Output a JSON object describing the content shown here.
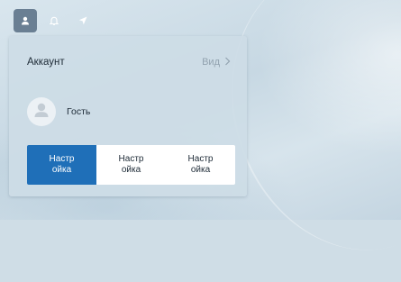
{
  "top_strip": {
    "buttons": [
      {
        "icon": "user-icon",
        "active": true
      },
      {
        "icon": "bell-icon",
        "active": false
      },
      {
        "icon": "location-arrow-icon",
        "active": false
      }
    ]
  },
  "panel": {
    "title": "Аккаунт",
    "view_link": "Вид",
    "user": {
      "name": "Гость",
      "avatar_icon": "user-avatar-icon"
    },
    "settings_buttons": [
      {
        "label": "Настр\nойка",
        "style": "primary"
      },
      {
        "label": "Настр\nойка",
        "style": "default"
      },
      {
        "label": "Настр\nойка",
        "style": "default"
      }
    ]
  },
  "colors": {
    "accent": "#1f6fb8",
    "panel_bg": "#cddce6",
    "active_tab": "#6a7f93"
  }
}
